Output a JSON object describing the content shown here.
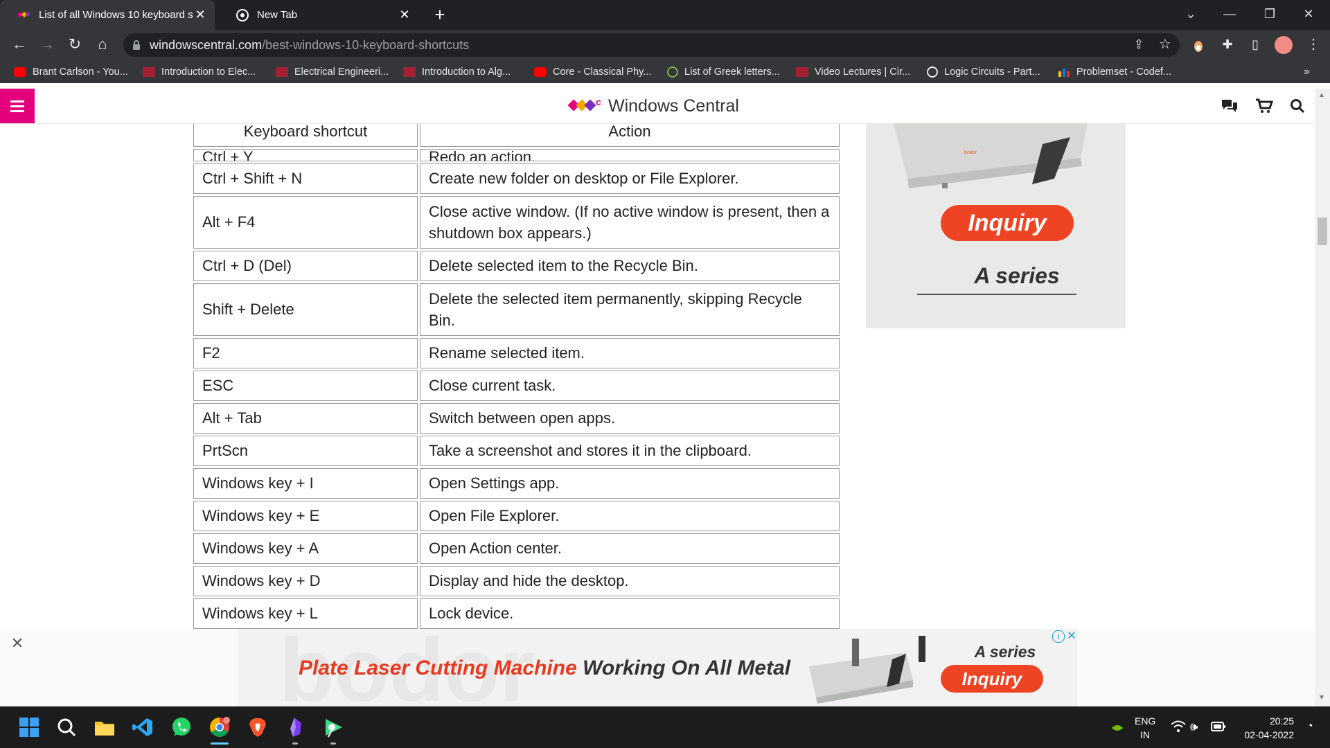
{
  "browser": {
    "tabs": [
      {
        "title": "List of all Windows 10 keyboard s",
        "active": true
      },
      {
        "title": "New Tab",
        "active": false
      }
    ],
    "url_domain": "windowscentral.com",
    "url_path": "/best-windows-10-keyboard-shortcuts",
    "bookmarks": [
      {
        "label": "Brant Carlson - You...",
        "icon": "youtube-icon"
      },
      {
        "label": "Introduction to Elec...",
        "icon": "mit-ocw-icon"
      },
      {
        "label": "Electrical Engineeri...",
        "icon": "mit-ocw-icon"
      },
      {
        "label": "Introduction to Alg...",
        "icon": "mit-ocw-icon"
      },
      {
        "label": "Core - Classical Phy...",
        "icon": "youtube-icon"
      },
      {
        "label": "List of Greek letters...",
        "icon": "leaf-icon"
      },
      {
        "label": "Video Lectures | Cir...",
        "icon": "mit-ocw-icon"
      },
      {
        "label": "Logic Circuits - Part...",
        "icon": "globe-icon"
      },
      {
        "label": "Problemset - Codef...",
        "icon": "codeforces-icon"
      }
    ],
    "bookmarks_overflow": "»"
  },
  "site": {
    "name": "Windows Central",
    "accent": "#e4007d"
  },
  "table": {
    "headers": [
      "Keyboard shortcut",
      "Action"
    ],
    "partial_top": {
      "shortcut": "Ctrl + Y",
      "action": "Redo an action."
    },
    "rows": [
      {
        "shortcut": "Ctrl + Shift + N",
        "action": "Create new folder on desktop or File Explorer."
      },
      {
        "shortcut": "Alt + F4",
        "action": "Close active window. (If no active window is present, then a shutdown box appears.)"
      },
      {
        "shortcut": "Ctrl + D (Del)",
        "action": "Delete selected item to the Recycle Bin."
      },
      {
        "shortcut": "Shift + Delete",
        "action": "Delete the selected item permanently, skipping Recycle Bin."
      },
      {
        "shortcut": "F2",
        "action": "Rename selected item."
      },
      {
        "shortcut": "ESC",
        "action": "Close current task."
      },
      {
        "shortcut": "Alt + Tab",
        "action": "Switch between open apps."
      },
      {
        "shortcut": "PrtScn",
        "action": "Take a screenshot and stores it in the clipboard."
      },
      {
        "shortcut": "Windows key + I",
        "action": "Open Settings app."
      },
      {
        "shortcut": "Windows key + E",
        "action": "Open File Explorer."
      },
      {
        "shortcut": "Windows key + A",
        "action": "Open Action center."
      },
      {
        "shortcut": "Windows key + D",
        "action": "Display and hide the desktop."
      }
    ],
    "partial_bottom": {
      "shortcut": "Windows key + L",
      "action": "Lock device."
    }
  },
  "side_ad": {
    "button": "Inquiry",
    "series": "A series",
    "brand": "bodor"
  },
  "bottom_ad": {
    "headline_red": "Plate Laser Cutting Machine",
    "headline_dark": "Working On All Metal",
    "series": "A series",
    "button": "Inquiry"
  },
  "taskbar": {
    "lang_top": "ENG",
    "lang_bottom": "IN",
    "time": "20:25",
    "date": "02-04-2022"
  }
}
